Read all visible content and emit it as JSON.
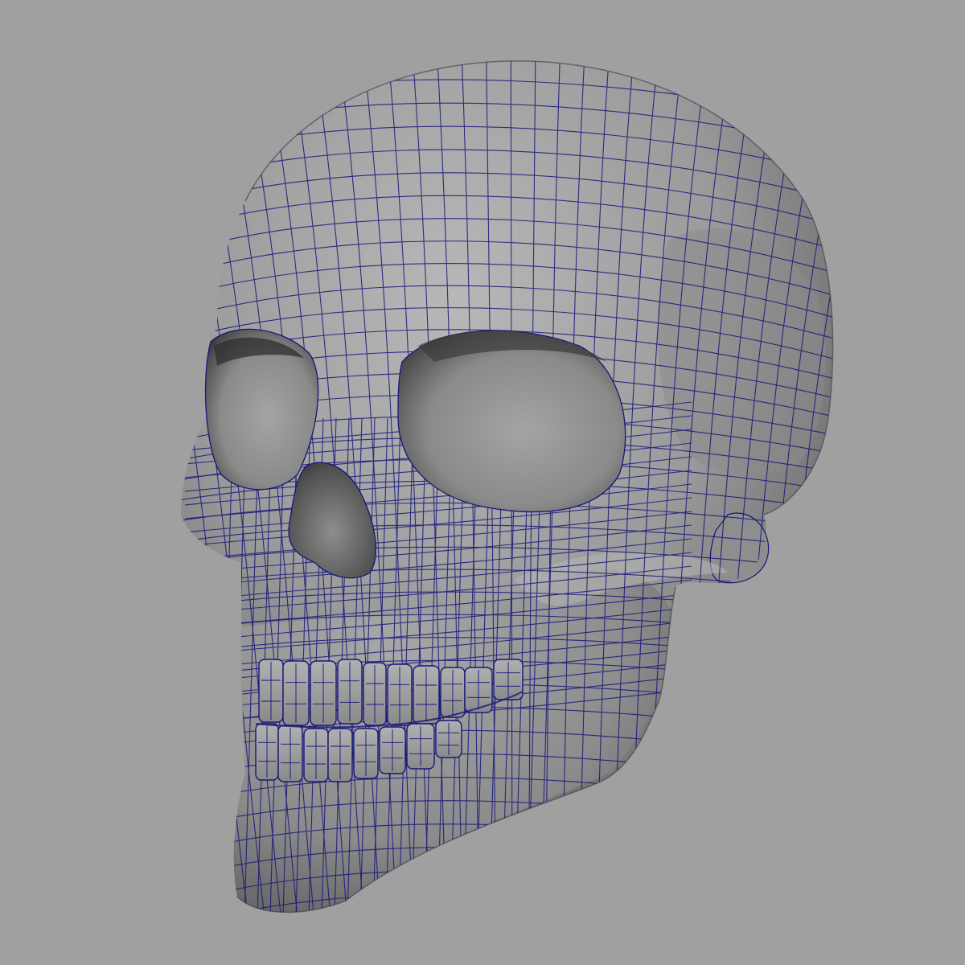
{
  "viewport": {
    "background_color": "#a0a0a0",
    "shading": "smooth-shaded-with-wireframe-overlay"
  },
  "model": {
    "subject": "skull",
    "surface_color": "#9c9c9c",
    "wireframe_color": "#16167a"
  }
}
